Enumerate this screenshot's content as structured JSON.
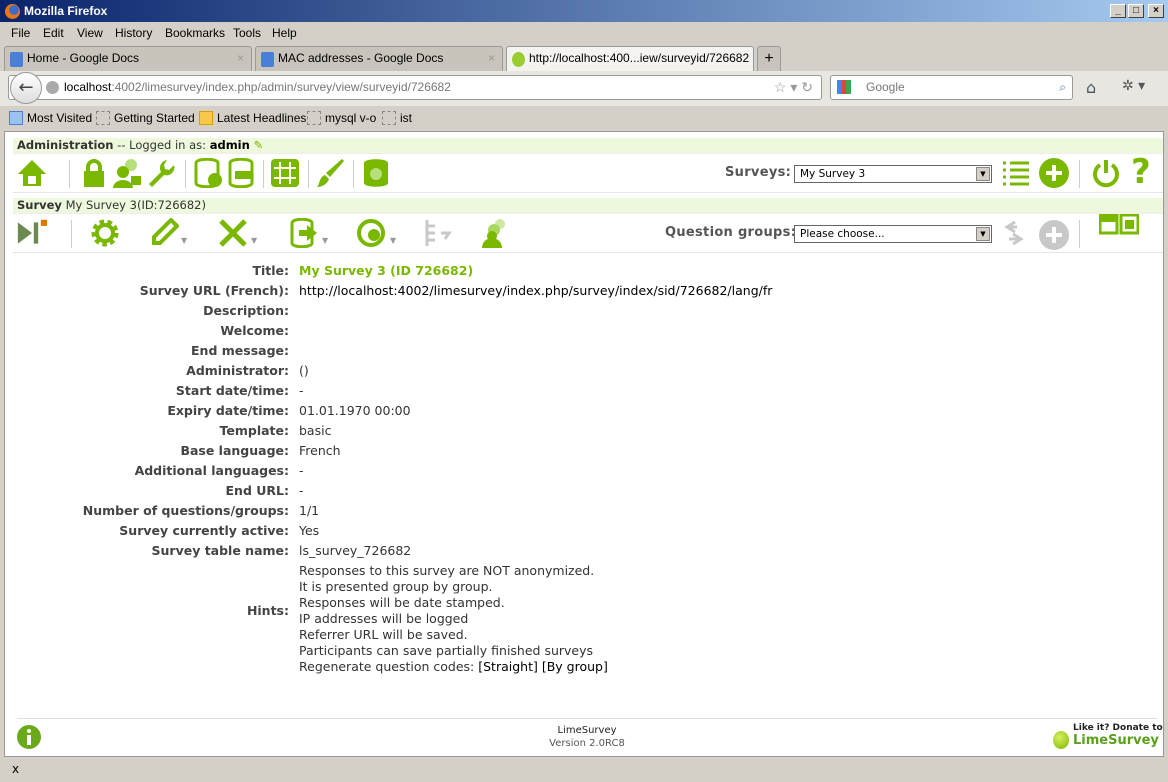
{
  "window": {
    "title": "Mozilla Firefox"
  },
  "menu": [
    "File",
    "Edit",
    "View",
    "History",
    "Bookmarks",
    "Tools",
    "Help"
  ],
  "tabs": [
    {
      "label": "Home - Google Docs"
    },
    {
      "label": "MAC addresses - Google Docs"
    },
    {
      "label": "http://localhost:400...iew/surveyid/726682"
    }
  ],
  "nav": {
    "url_host": "localhost",
    "url_rest": ":4002/limesurvey/index.php/admin/survey/view/surveyid/726682",
    "search_placeholder": "Google"
  },
  "bookmarks": [
    "Most Visited",
    "Getting Started",
    "Latest Headlines",
    "mysql v-o",
    "ist"
  ],
  "admin": {
    "heading": "Administration",
    "logged_in": " -- Logged in as: ",
    "user": "admin",
    "surveys_label": "Surveys:",
    "surveys_selected": "My Survey 3"
  },
  "survey": {
    "heading": "Survey",
    "name": "My Survey 3(ID:726682)",
    "groups_label": "Question groups:",
    "groups_selected": "Please choose..."
  },
  "details": [
    {
      "k": "Title:",
      "v": "My Survey 3 (ID 726682)"
    },
    {
      "k": "Survey URL (French):",
      "v": "http://localhost:4002/limesurvey/index.php/survey/index/sid/726682/lang/fr"
    },
    {
      "k": "Description:",
      "v": ""
    },
    {
      "k": "Welcome:",
      "v": ""
    },
    {
      "k": "End message:",
      "v": ""
    },
    {
      "k": "Administrator:",
      "v": "()"
    },
    {
      "k": "Start date/time:",
      "v": "-"
    },
    {
      "k": "Expiry date/time:",
      "v": "01.01.1970 00:00"
    },
    {
      "k": "Template:",
      "v": "basic"
    },
    {
      "k": "Base language:",
      "v": "French"
    },
    {
      "k": "Additional languages:",
      "v": "-"
    },
    {
      "k": "End URL:",
      "v": "-"
    },
    {
      "k": "Number of questions/groups:",
      "v": "1/1"
    },
    {
      "k": "Survey currently active:",
      "v": "Yes"
    },
    {
      "k": "Survey table name:",
      "v": "ls_survey_726682"
    }
  ],
  "hints": {
    "label": "Hints:",
    "lines": [
      "Responses to this survey are NOT anonymized.",
      "It is presented group by group.",
      "Responses will be date stamped.",
      "IP addresses will be logged",
      "Referrer URL will be saved.",
      "Participants can save partially finished surveys"
    ],
    "regen": "Regenerate question codes:",
    "straight": "[Straight]",
    "bygroup": "[By group]"
  },
  "footer": {
    "app": "LimeSurvey",
    "version": "Version 2.0RC8",
    "donate1": "Like it? Donate to",
    "donate2": "LimeSurvey"
  },
  "status": {
    "close": "x"
  },
  "colors": {
    "accent": "#7ab800",
    "header_bg": "#eef8dd"
  }
}
